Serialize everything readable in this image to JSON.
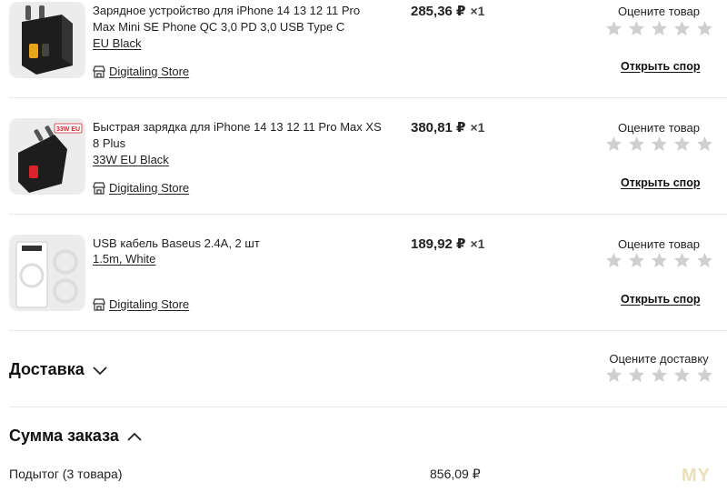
{
  "items": [
    {
      "title": "Зарядное устройство для iPhone 14 13 12 11 Pro Max Mini SE Phone QC 3,0 PD 3,0 USB Type C",
      "variant": "EU Black",
      "store": "Digitaling Store",
      "price": "285,36 ₽",
      "qty": "×1",
      "rate_label": "Оцените товар",
      "dispute": "Открыть спор",
      "stars": 5
    },
    {
      "title": "Быстрая зарядка для iPhone 14 13 12 11 Pro Max XS 8 Plus",
      "variant": "33W EU Black",
      "store": "Digitaling Store",
      "price": "380,81 ₽",
      "qty": "×1",
      "rate_label": "Оцените товар",
      "dispute": "Открыть спор",
      "badge": "33W EU",
      "stars": 5
    },
    {
      "title": "USB кабель Baseus 2.4A, 2 шт",
      "variant": "1.5m, White",
      "store": "Digitaling Store",
      "price": "189,92 ₽",
      "qty": "×1",
      "rate_label": "Оцените товар",
      "dispute": "Открыть спор",
      "stars": 5
    }
  ],
  "delivery": {
    "title": "Доставка",
    "rate_label": "Оцените доставку"
  },
  "summary": {
    "title": "Сумма заказа",
    "subtotal_label": "Подытог (3 товара)",
    "subtotal_value": "856,09 ₽"
  },
  "watermark": "MY",
  "colors": {
    "star_inactive": "#cfcfcf",
    "divider": "#e8e8e8",
    "badge_red": "#d9232d"
  }
}
